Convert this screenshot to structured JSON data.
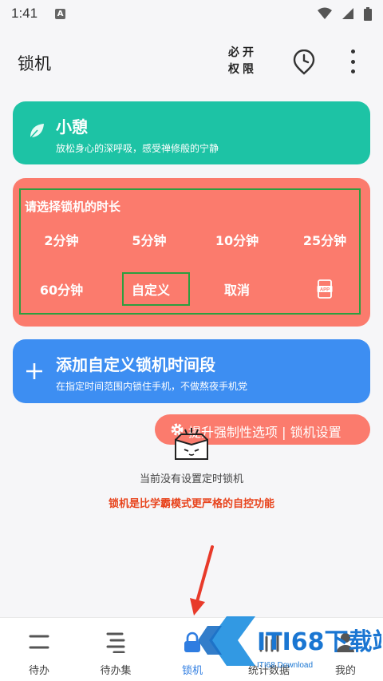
{
  "status_bar": {
    "time": "1:41",
    "notification_glyph": "A"
  },
  "app_bar": {
    "title": "锁机",
    "must_permission_line1": "必开",
    "must_permission_line2": "权限"
  },
  "rest_card": {
    "title": "小憩",
    "subtitle": "放松身心的深呼吸，感受禅修般的宁静",
    "color": "#1dc3a5"
  },
  "duration_card": {
    "title": "请选择锁机的时长",
    "color": "#fb7b6d",
    "options": [
      "2分钟",
      "5分钟",
      "10分钟",
      "25分钟",
      "60分钟",
      "自定义",
      "取消"
    ],
    "app_icon_text": "APP"
  },
  "add_card": {
    "title": "添加自定义锁机时间段",
    "subtitle": "在指定时间范围内锁住手机，不做熬夜手机党",
    "color": "#3d8ef2"
  },
  "settings_pill": {
    "label": "提升强制性选项 | 锁机设置"
  },
  "empty_state": {
    "message": "当前没有设置定时锁机",
    "hint": "锁机是比学霸模式更严格的自控功能"
  },
  "bottom_nav": {
    "active_color": "#2f7de1",
    "items": [
      {
        "label": "待办",
        "icon": "todo-icon"
      },
      {
        "label": "待办集",
        "icon": "todo-collection-icon"
      },
      {
        "label": "锁机",
        "icon": "lock-icon"
      },
      {
        "label": "统计数据",
        "icon": "statistics-icon"
      },
      {
        "label": "我的",
        "icon": "profile-icon"
      }
    ]
  },
  "watermark": {
    "brand": "ITI68下载站",
    "sub": "ITI68 Download"
  }
}
